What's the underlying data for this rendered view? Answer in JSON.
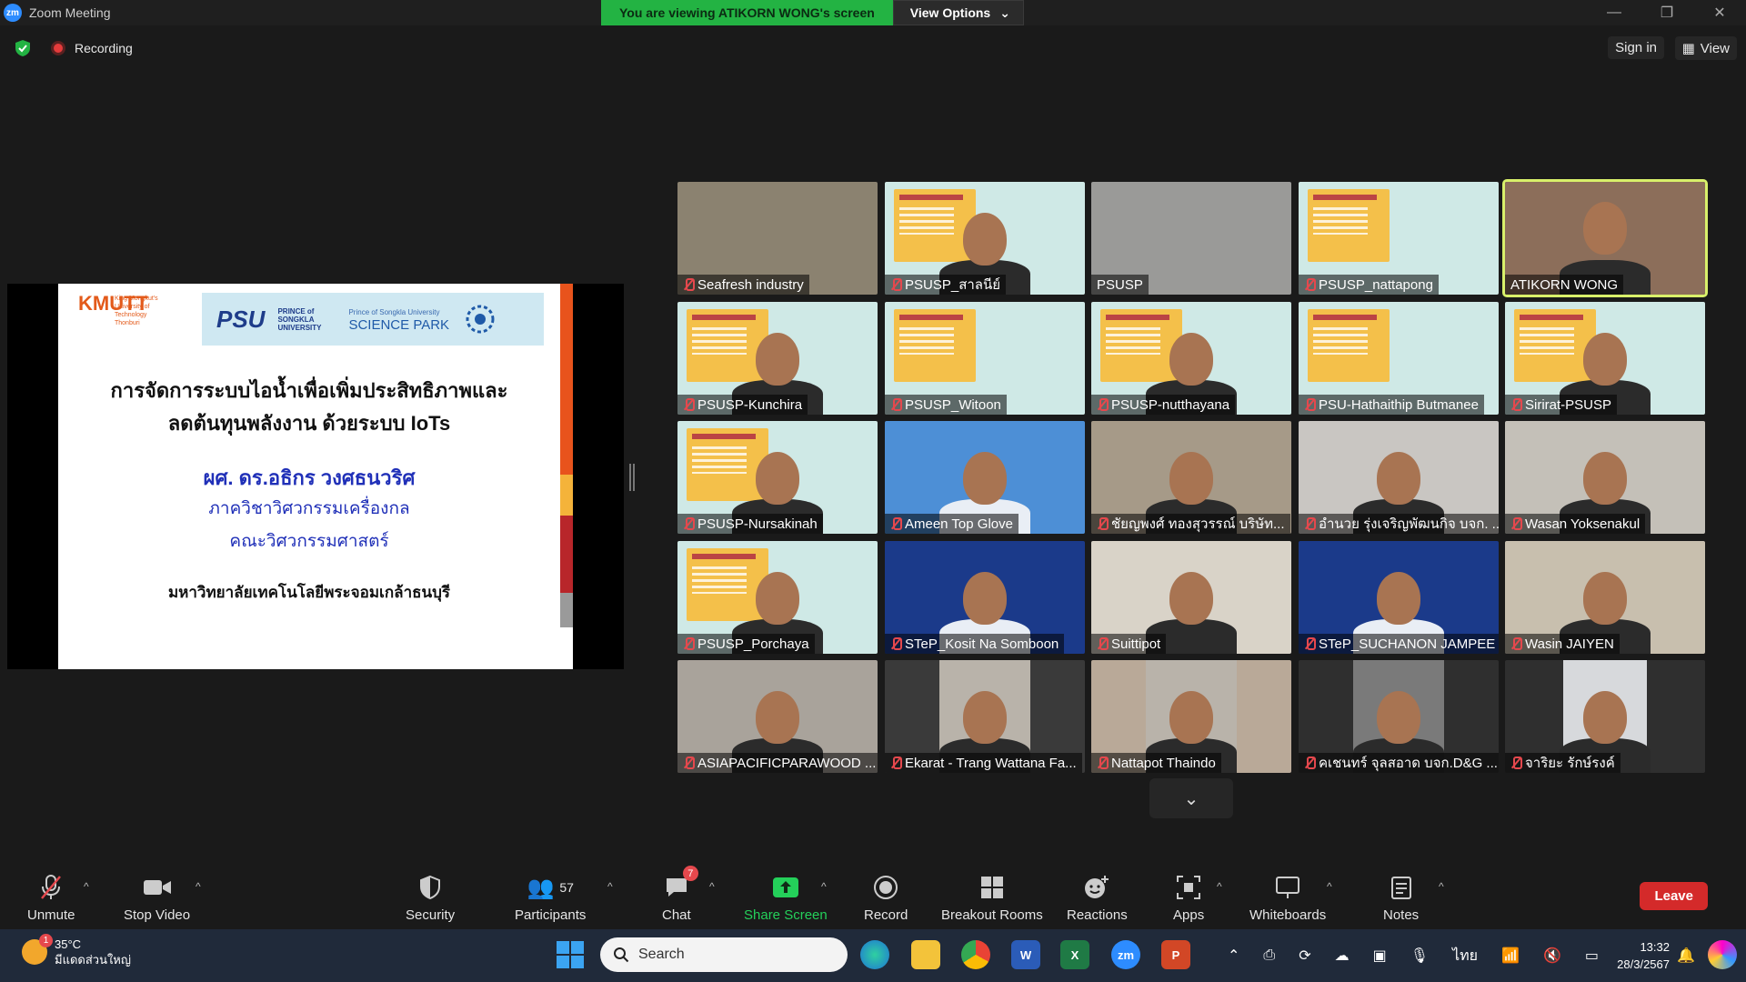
{
  "window": {
    "title": "Zoom Meeting",
    "logo": "zm",
    "controls": [
      "—",
      "❐",
      "✕"
    ]
  },
  "banner": {
    "viewing": "You are viewing ATIKORN WONG's screen",
    "view_options": "View Options"
  },
  "meeting": {
    "recording": "Recording",
    "sign_in": "Sign in",
    "view": "View"
  },
  "slide": {
    "kmutt_mark": "KMUTT",
    "kmutt_text": "King Mongkut's University of Technology Thonburi",
    "psu": "PSU",
    "psu_small": "PRINCE of SONGKLA UNIVERSITY",
    "scipark_small": "Prince of Songkla University",
    "scipark": "SCIENCE PARK",
    "title_1": "การจัดการระบบไอน้ำเพื่อเพิ่มประสิทธิภาพและ",
    "title_2": "ลดต้นทุนพลังงาน ด้วยระบบ IoTs",
    "presenter": "ผศ. ดร.อธิกร วงศธนวริศ",
    "department": "ภาควิชาวิศวกรรมเครื่องกล",
    "faculty": "คณะวิศวกรรมศาสตร์",
    "university": "มหาวิทยาลัยเทคโนโลยีพระจอมเกล้าธนบุรี"
  },
  "participants_tiles": [
    {
      "name": "Seafresh industry"
    },
    {
      "name": "PSUSP_สาลนีย์"
    },
    {
      "name": "PSUSP"
    },
    {
      "name": "PSUSP_nattapong"
    },
    {
      "name": "ATIKORN WONG"
    },
    {
      "name": "PSUSP-Kunchira"
    },
    {
      "name": "PSUSP_Witoon"
    },
    {
      "name": "PSUSP-nutthayana"
    },
    {
      "name": "PSU-Hathaithip Butmanee"
    },
    {
      "name": "Sirirat-PSUSP"
    },
    {
      "name": "PSUSP-Nursakinah"
    },
    {
      "name": "Ameen Top Glove"
    },
    {
      "name": "ชัยญพงศ์ ทองสุวรรณ์ บริษัท..."
    },
    {
      "name": "อำนวย รุ่งเจริญพัฒนกิจ บจก. ..."
    },
    {
      "name": "Wasan Yoksenakul"
    },
    {
      "name": "PSUSP_Porchaya"
    },
    {
      "name": "STeP_Kosit Na Somboon"
    },
    {
      "name": "Suittipot"
    },
    {
      "name": "STeP_SUCHANON JAMPEE"
    },
    {
      "name": "Wasin JAIYEN"
    },
    {
      "name": "ASIAPACIFICPARAWOOD ..."
    },
    {
      "name": "Ekarat - Trang Wattana Fa..."
    },
    {
      "name": "Nattapot Thaindo"
    },
    {
      "name": "คเชนทร์ จุลสอาด บจก.D&G ..."
    },
    {
      "name": "จาริยะ รักษ์รงค์"
    }
  ],
  "toolbar": {
    "unmute": "Unmute",
    "stop_video": "Stop Video",
    "security": "Security",
    "participants": "Participants",
    "participants_count": "57",
    "chat": "Chat",
    "chat_badge": "7",
    "share_screen": "Share Screen",
    "record": "Record",
    "breakout": "Breakout Rooms",
    "reactions": "Reactions",
    "apps": "Apps",
    "whiteboards": "Whiteboards",
    "notes": "Notes",
    "leave": "Leave"
  },
  "taskbar": {
    "temp": "35°C",
    "weather": "มีแดดส่วนใหญ่",
    "weather_badge": "1",
    "search": "Search",
    "lang": "ไทย",
    "time": "13:32",
    "date": "28/3/2567"
  }
}
